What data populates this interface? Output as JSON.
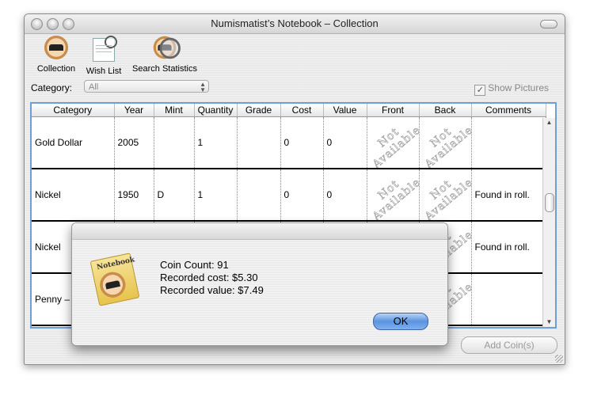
{
  "window": {
    "title": "Numismatist’s Notebook – Collection"
  },
  "toolbar": {
    "items": [
      {
        "label": "Collection",
        "icon": "collection-icon"
      },
      {
        "label": "Wish List",
        "icon": "wish-list-icon"
      },
      {
        "label": "Search Statistics",
        "icon": "search-statistics-icon"
      }
    ]
  },
  "filter": {
    "category_label": "Category:",
    "category_value": "All",
    "show_pictures_label": "Show Pictures",
    "show_pictures_checked": true
  },
  "table": {
    "columns": [
      "Category",
      "Year",
      "Mint",
      "Quantity",
      "Grade",
      "Cost",
      "Value",
      "Front",
      "Back",
      "Comments"
    ],
    "not_available": "Not Available",
    "rows": [
      {
        "category": "Gold Dollar",
        "year": "2005",
        "mint": "",
        "quantity": "1",
        "grade": "",
        "cost": "0",
        "value": "0",
        "comments": ""
      },
      {
        "category": "Nickel",
        "year": "1950",
        "mint": "D",
        "quantity": "1",
        "grade": "",
        "cost": "0",
        "value": "0",
        "comments": "Found in roll."
      },
      {
        "category": "Nickel",
        "year": "",
        "mint": "",
        "quantity": "",
        "grade": "",
        "cost": "",
        "value": "",
        "comments": "Found in roll."
      },
      {
        "category": "Penny – S",
        "year": "",
        "mint": "",
        "quantity": "",
        "grade": "",
        "cost": "",
        "value": "",
        "comments": ""
      }
    ]
  },
  "footer": {
    "add_button": "Add Coin(s)"
  },
  "dialog": {
    "icon_label": "Notebook",
    "line1": "Coin Count: 91",
    "line2": "Recorded cost: $5.30",
    "line3": "Recorded value: $7.49",
    "ok": "OK"
  },
  "colors": {
    "table_focus": "#6f9ed6",
    "ok_button": "#5b94e0"
  }
}
